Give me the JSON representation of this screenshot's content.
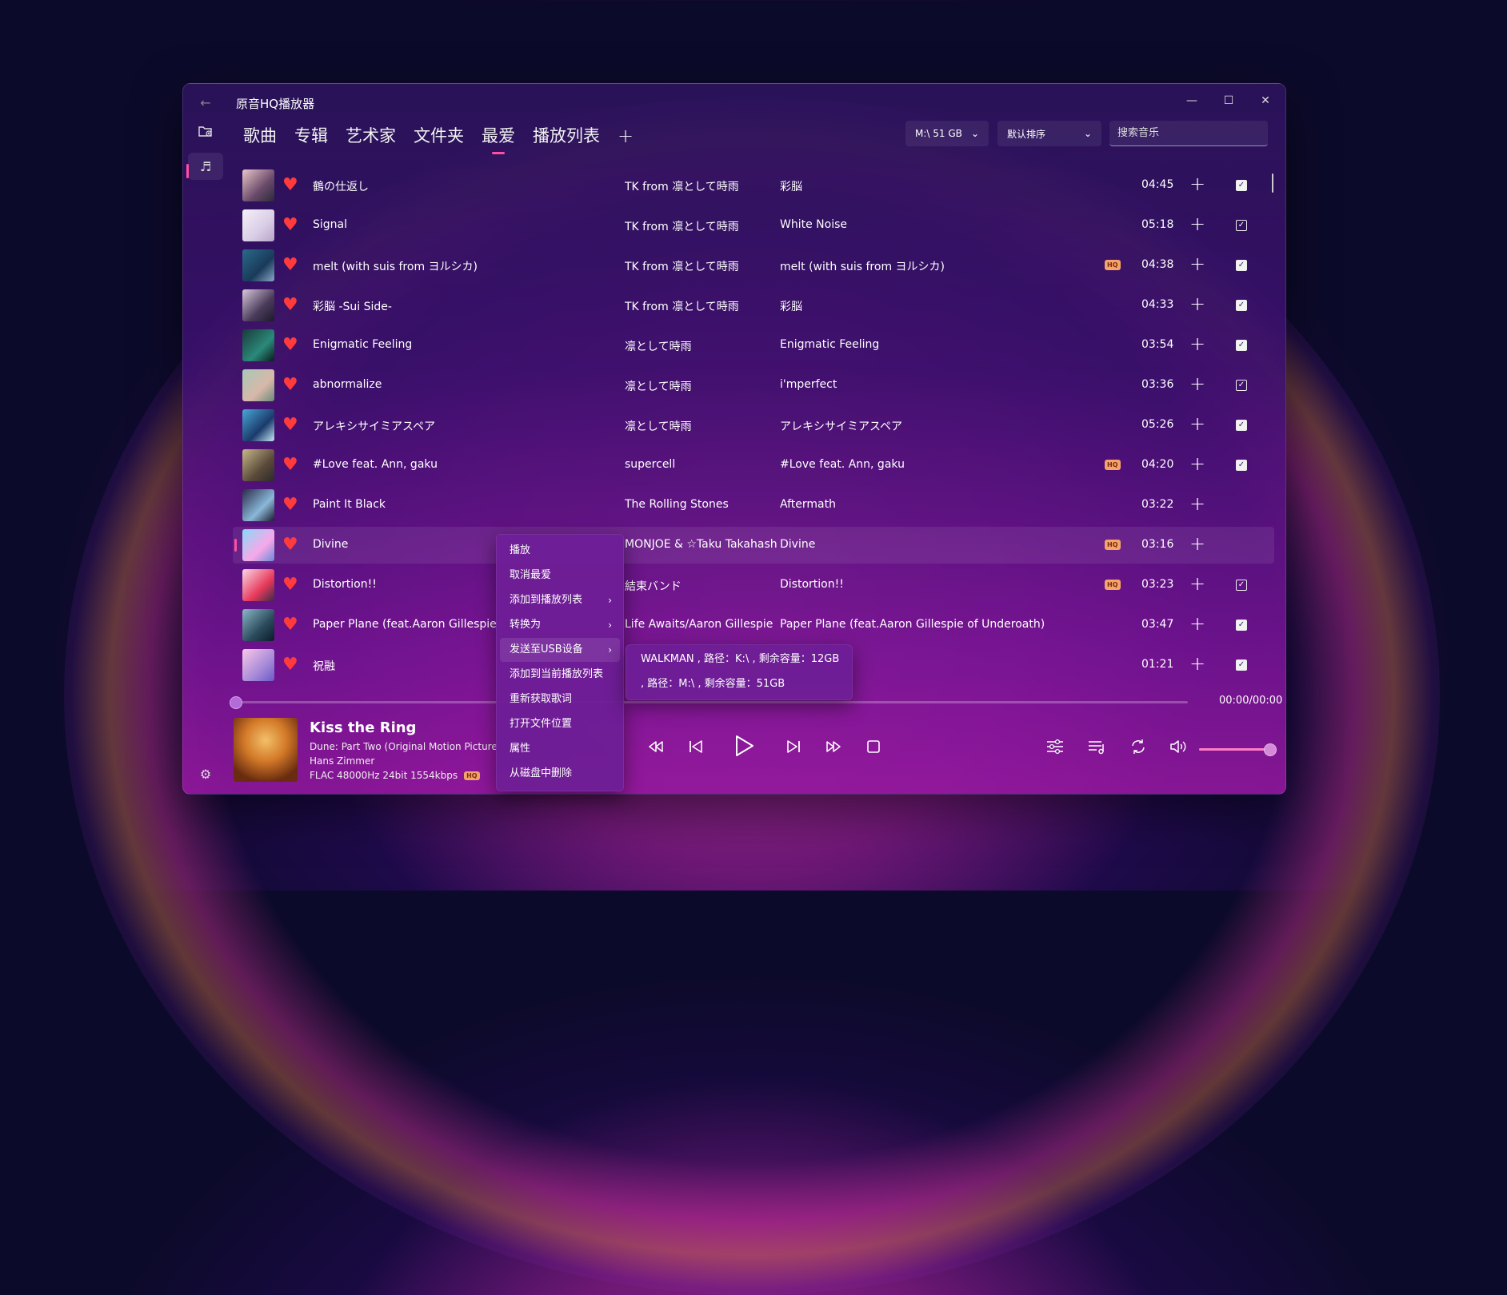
{
  "app": {
    "title": "原音HQ播放器"
  },
  "window_controls": {
    "minimize": "—",
    "maximize": "☐",
    "close": "✕"
  },
  "sidebar": {
    "back_icon": "back-arrow-icon",
    "items": [
      "folder-add-icon",
      "music-note-icon"
    ],
    "settings_icon": "gear-icon"
  },
  "tabs": [
    {
      "label": "歌曲"
    },
    {
      "label": "专辑"
    },
    {
      "label": "艺术家"
    },
    {
      "label": "文件夹"
    },
    {
      "label": "最爱"
    },
    {
      "label": "播放列表"
    },
    {
      "label": "+"
    }
  ],
  "active_tab": "最爱",
  "toolbar": {
    "drive_label": "M:\\ 51 GB",
    "sort_label": "默认排序",
    "search_placeholder": "搜索音乐"
  },
  "songs": [
    {
      "title": "鶴の仕返し",
      "artist": "TK from 凛として時雨",
      "album": "彩脳",
      "hq": false,
      "duration": "04:45",
      "checked": "filled"
    },
    {
      "title": "Signal",
      "artist": "TK from 凛として時雨",
      "album": "White Noise",
      "hq": false,
      "duration": "05:18",
      "checked": "outline"
    },
    {
      "title": "melt (with suis from ヨルシカ)",
      "artist": "TK from 凛として時雨",
      "album": "melt (with suis from ヨルシカ)",
      "hq": true,
      "duration": "04:38",
      "checked": "filled"
    },
    {
      "title": "彩脳 -Sui Side-",
      "artist": "TK from 凛として時雨",
      "album": "彩脳",
      "hq": false,
      "duration": "04:33",
      "checked": "filled"
    },
    {
      "title": "Enigmatic Feeling",
      "artist": "凛として時雨",
      "album": "Enigmatic Feeling",
      "hq": false,
      "duration": "03:54",
      "checked": "filled"
    },
    {
      "title": "abnormalize",
      "artist": "凛として時雨",
      "album": "i'mperfect",
      "hq": false,
      "duration": "03:36",
      "checked": "outline"
    },
    {
      "title": "アレキシサイミアスペア",
      "artist": "凛として時雨",
      "album": "アレキシサイミアスペア",
      "hq": false,
      "duration": "05:26",
      "checked": "filled"
    },
    {
      "title": "#Love feat. Ann, gaku",
      "artist": "supercell",
      "album": "#Love feat. Ann, gaku",
      "hq": true,
      "duration": "04:20",
      "checked": "filled"
    },
    {
      "title": "Paint It Black",
      "artist": "The Rolling Stones",
      "album": "Aftermath",
      "hq": false,
      "duration": "03:22",
      "checked": "none"
    },
    {
      "title": "Divine",
      "artist": "MONJOE & ☆Taku Takahash...",
      "album": "Divine",
      "hq": true,
      "duration": "03:16",
      "checked": "none"
    },
    {
      "title": "Distortion!!",
      "artist": "結束バンド",
      "album": "Distortion!!",
      "hq": true,
      "duration": "03:23",
      "checked": "outline"
    },
    {
      "title": "Paper Plane (feat.Aaron Gillespie of Underoath)",
      "artist": "Life Awaits/Aaron Gillespie",
      "album": "Paper Plane (feat.Aaron Gillespie of Underoath)",
      "hq": false,
      "duration": "03:47",
      "checked": "filled"
    },
    {
      "title": "祝融",
      "artist": "",
      "album": "",
      "hq": false,
      "duration": "01:21",
      "checked": "filled"
    }
  ],
  "hq_label": "HQ",
  "plus_label": "+",
  "selected_row": 9,
  "context_menu": {
    "items": [
      {
        "label": "播放",
        "submenu": false
      },
      {
        "label": "取消最爱",
        "submenu": false
      },
      {
        "label": "添加到播放列表",
        "submenu": true
      },
      {
        "label": "转换为",
        "submenu": true
      },
      {
        "label": "发送至USB设备",
        "submenu": true
      },
      {
        "label": "添加到当前播放列表",
        "submenu": false
      },
      {
        "label": "重新获取歌词",
        "submenu": false
      },
      {
        "label": "打开文件位置",
        "submenu": false
      },
      {
        "label": "属性",
        "submenu": false
      },
      {
        "label": "从磁盘中删除",
        "submenu": false
      }
    ],
    "highlighted": 4,
    "arrow": "›"
  },
  "usb_submenu": [
    {
      "label": "WALKMAN , 路径：K:\\ , 剩余容量：12GB"
    },
    {
      "label": " , 路径：M:\\ , 剩余容量：51GB"
    }
  ],
  "player": {
    "time": "00:00/00:00",
    "title": "Kiss the Ring",
    "album": "Dune: Part Two (Original Motion Picture Soundtrack)",
    "artist": "Hans Zimmer",
    "format": "FLAC 48000Hz 24bit 1554kbps",
    "hq": true,
    "progress": 0,
    "volume": 1.0
  },
  "colors": {
    "accent": "#ff4fa0",
    "heart": "#ff3b3b",
    "hq_bg": "#f5a46a"
  }
}
